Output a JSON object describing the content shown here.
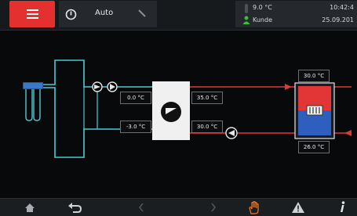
{
  "header": {
    "mode_label": "Auto",
    "outdoor_temp": "9.0 °C",
    "user": "Kunde",
    "time": "10:42:4",
    "date": "25.09.201"
  },
  "diagram": {
    "source_temp": "0.0 °C",
    "source_return_temp": "-3.0 °C",
    "flow_temp": "35.0 °C",
    "return_temp": "30.0 °C",
    "buffer_top_temp": "30.0 °C",
    "buffer_bottom_temp": "26.0 °C"
  },
  "colors": {
    "accent_red": "#e4302e",
    "brine_cyan": "#4fc9d2",
    "heating_red": "#e23636",
    "user_green": "#3bbf3b",
    "warning_orange": "#f07c2a"
  },
  "icons": [
    "menu-icon",
    "power-icon",
    "edit-icon",
    "thermometer-icon",
    "user-icon",
    "ground-probe-icon",
    "pump-icon",
    "heat-pump-icon",
    "buffer-tank-icon",
    "home-icon",
    "back-icon",
    "prev-icon",
    "next-icon",
    "manual-hand-icon",
    "warning-icon",
    "info-icon"
  ]
}
